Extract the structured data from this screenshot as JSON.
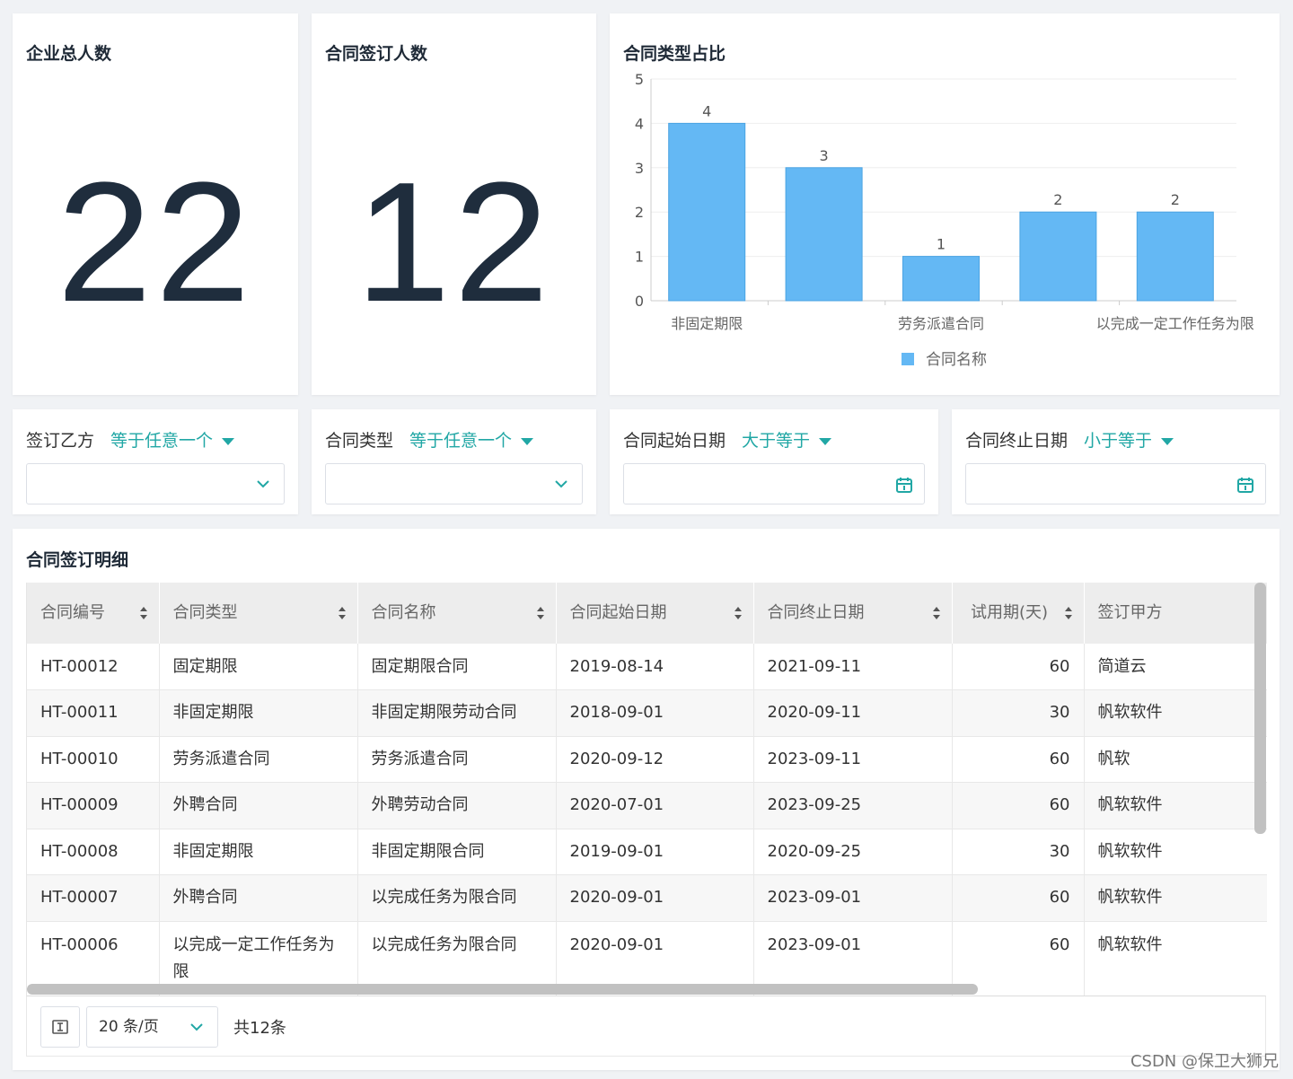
{
  "kpi": {
    "total_employees_title": "企业总人数",
    "total_employees_value": "22",
    "signed_title": "合同签订人数",
    "signed_value": "12"
  },
  "chart_card": {
    "title": "合同类型占比"
  },
  "chart_data": {
    "type": "bar",
    "categories": [
      "非固定期限",
      "",
      "劳务派遣合同",
      "",
      "以完成一定工作任务为限"
    ],
    "series": [
      {
        "name": "合同名称",
        "values": [
          4,
          3,
          1,
          2,
          2
        ]
      }
    ],
    "ylim": [
      0,
      5
    ],
    "yticks": [
      "0",
      "1",
      "2",
      "3",
      "4",
      "5"
    ],
    "bar_color": "#64b8f4",
    "legend_position": "bottom",
    "grid": true
  },
  "filters": [
    {
      "label": "签订乙方",
      "operator": "等于任意一个",
      "kind": "select"
    },
    {
      "label": "合同类型",
      "operator": "等于任意一个",
      "kind": "select"
    },
    {
      "label": "合同起始日期",
      "operator": "大于等于",
      "kind": "date"
    },
    {
      "label": "合同终止日期",
      "operator": "小于等于",
      "kind": "date"
    }
  ],
  "detail": {
    "title": "合同签订明细",
    "columns": [
      "合同编号",
      "合同类型",
      "合同名称",
      "合同起始日期",
      "合同终止日期",
      "试用期(天)",
      "签订甲方"
    ],
    "rows": [
      [
        "HT-00012",
        "固定期限",
        "固定期限合同",
        "2019-08-14",
        "2021-09-11",
        "60",
        "简道云"
      ],
      [
        "HT-00011",
        "非固定期限",
        "非固定期限劳动合同",
        "2018-09-01",
        "2020-09-11",
        "30",
        "帆软软件"
      ],
      [
        "HT-00010",
        "劳务派遣合同",
        "劳务派遣合同",
        "2020-09-12",
        "2023-09-11",
        "60",
        "帆软"
      ],
      [
        "HT-00009",
        "外聘合同",
        "外聘劳动合同",
        "2020-07-01",
        "2023-09-25",
        "60",
        "帆软软件"
      ],
      [
        "HT-00008",
        "非固定期限",
        "非固定期限合同",
        "2019-09-01",
        "2020-09-25",
        "30",
        "帆软软件"
      ],
      [
        "HT-00007",
        "外聘合同",
        "以完成任务为限合同",
        "2020-09-01",
        "2023-09-01",
        "60",
        "帆软软件"
      ],
      [
        "HT-00006",
        "以完成一定工作任务为限",
        "以完成任务为限合同",
        "2020-09-01",
        "2023-09-01",
        "60",
        "帆软软件"
      ]
    ],
    "page_size": "20 条/页",
    "total": "共12条"
  },
  "colors": {
    "accent": "#21a7a5",
    "bar": "#64b8f4",
    "number": "#1f2d3d"
  },
  "watermark": "CSDN @保卫大狮兄"
}
